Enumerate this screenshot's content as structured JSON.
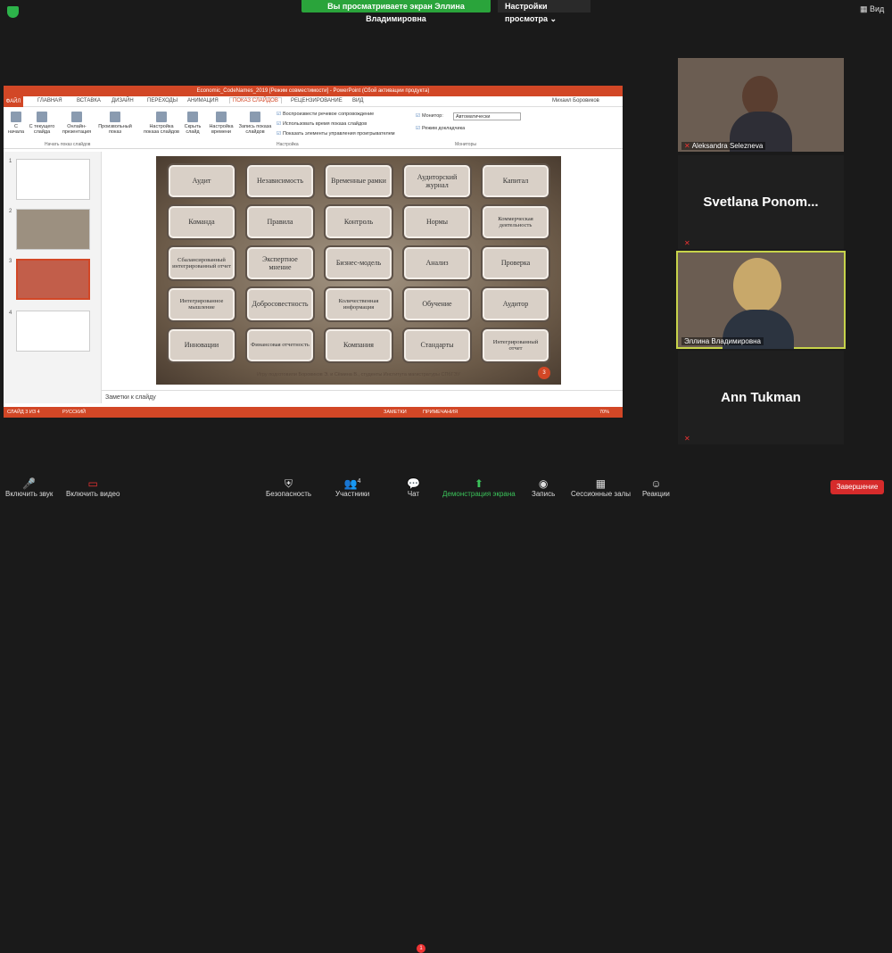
{
  "zoom": {
    "share_banner": "Вы просматриваете экран Эллина Владимировна",
    "view_settings": "Настройки просмотра ⌄",
    "view_button": "▦ Вид",
    "end_button": "Завершение",
    "toolbar": {
      "mute": "Включить звук",
      "video": "Включить видео",
      "security": "Безопасность",
      "participants": "Участники",
      "participants_count": "4",
      "chat": "Чат",
      "chat_badge": "1",
      "share": "Демонстрация экрана",
      "record": "Запись",
      "breakout": "Сессионные залы",
      "reactions": "Реакции"
    },
    "participants": [
      {
        "name": "Aleksandra Selezneva",
        "video": true
      },
      {
        "name": "Svetlana  Ponom...",
        "video": false
      },
      {
        "name": "Эллина Владимировна",
        "video": true
      },
      {
        "name": "Ann Tukman",
        "video": false
      }
    ]
  },
  "ppt": {
    "title": "Economic_CodeNames_2019 [Режим совместимости] - PowerPoint (Сбой активации продукта)",
    "user": "Михаил Боровиков",
    "tabs": [
      "ФАЙЛ",
      "ГЛАВНАЯ",
      "ВСТАВКА",
      "ДИЗАЙН",
      "ПЕРЕХОДЫ",
      "АНИМАЦИЯ",
      "ПОКАЗ СЛАЙДОВ",
      "РЕЦЕНЗИРОВАНИЕ",
      "ВИД"
    ],
    "ribbon": {
      "from_start": "С начала",
      "from_current": "С текущего слайда",
      "online": "Онлайн-презентация",
      "custom": "Произвольный показ",
      "group1": "Начать показ слайдов",
      "setup": "Настройка показа слайдов",
      "hide": "Скрыть слайд",
      "timings": "Настройка времени",
      "record": "Запись показа слайдов",
      "chk1": "Воспроизвести речевое сопровождение",
      "chk2": "Использовать время показа слайдов",
      "chk3": "Показать элементы управления проигрывателем",
      "group2": "Настройка",
      "monitor_label": "Монитор:",
      "monitor_value": "Автоматически",
      "presenter": "Режим докладчика",
      "group3": "Мониторы"
    },
    "thumbs": [
      "1",
      "2",
      "3",
      "4"
    ],
    "slide": {
      "cards": [
        "Аудит",
        "Независимость",
        "Временные рамки",
        "Аудиторский журнал",
        "Капитал",
        "Команда",
        "Правила",
        "Контроль",
        "Нормы",
        "Коммерческая деятельность",
        "Сбалансированный интегрированный отчет",
        "Экспертное мнение",
        "Бизнес-модель",
        "Анализ",
        "Проверка",
        "Интегрированное мышление",
        "Добросовестность",
        "Количественная информация",
        "Обучение",
        "Аудитор",
        "Инновации",
        "Финансовая отчетность",
        "Компания",
        "Стандарты",
        "Интегрированный отчет"
      ],
      "footer": "Игру подготовили Боровиков Э. и Сёмина В., студенты Института магистратуры СПбГЭУ",
      "number": "3"
    },
    "notes": "Заметки к слайду",
    "status": {
      "slide": "СЛАЙД 3 ИЗ 4",
      "lang": "РУССКИЙ",
      "notes": "ЗАМЕТКИ",
      "comments": "ПРИМЕЧАНИЯ",
      "zoom": "70%"
    }
  }
}
